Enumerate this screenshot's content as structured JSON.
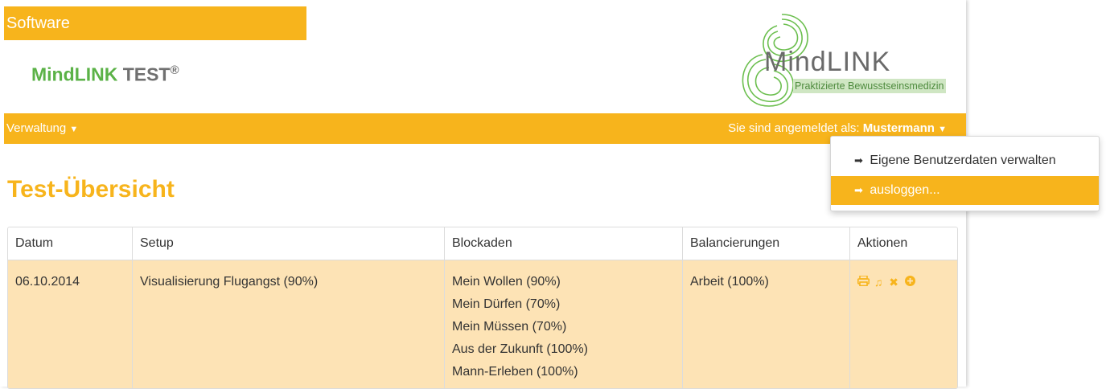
{
  "header": {
    "software_tab": "Software",
    "brand_green": "MindLINK",
    "brand_grey": "TEST",
    "brand_mark": "®",
    "logo_word": "MindLINK",
    "logo_sub": "Praktizierte Bewusstseinsmedizin"
  },
  "navbar": {
    "menu_label": "Verwaltung",
    "logged_in_text": "Sie sind angemeldet als:",
    "user_name": "Mustermann"
  },
  "user_menu": {
    "items": [
      {
        "label": "Eigene Benutzerdaten verwalten",
        "icon": "sign-in-icon",
        "active": false
      },
      {
        "label": "ausloggen...",
        "icon": "sign-out-icon",
        "active": true
      }
    ]
  },
  "main": {
    "title": "Test-Übersicht",
    "table": {
      "columns": [
        "Datum",
        "Setup",
        "Blockaden",
        "Balancierungen",
        "Aktionen"
      ],
      "rows": [
        {
          "datum": "06.10.2014",
          "setup": "Visualisierung Flugangst (90%)",
          "blockaden": [
            "Mein Wollen (90%)",
            "Mein Dürfen (70%)",
            "Mein Müssen (70%)",
            "Aus der Zukunft (100%)",
            "Mann-Erleben (100%)"
          ],
          "balancierungen": "Arbeit (100%)",
          "actions": [
            "print-icon",
            "music-icon",
            "delete-icon",
            "add-icon"
          ]
        }
      ]
    }
  },
  "colors": {
    "accent": "#f7b41c",
    "brand_green": "#5bb247",
    "row_bg": "#fde3b5"
  }
}
